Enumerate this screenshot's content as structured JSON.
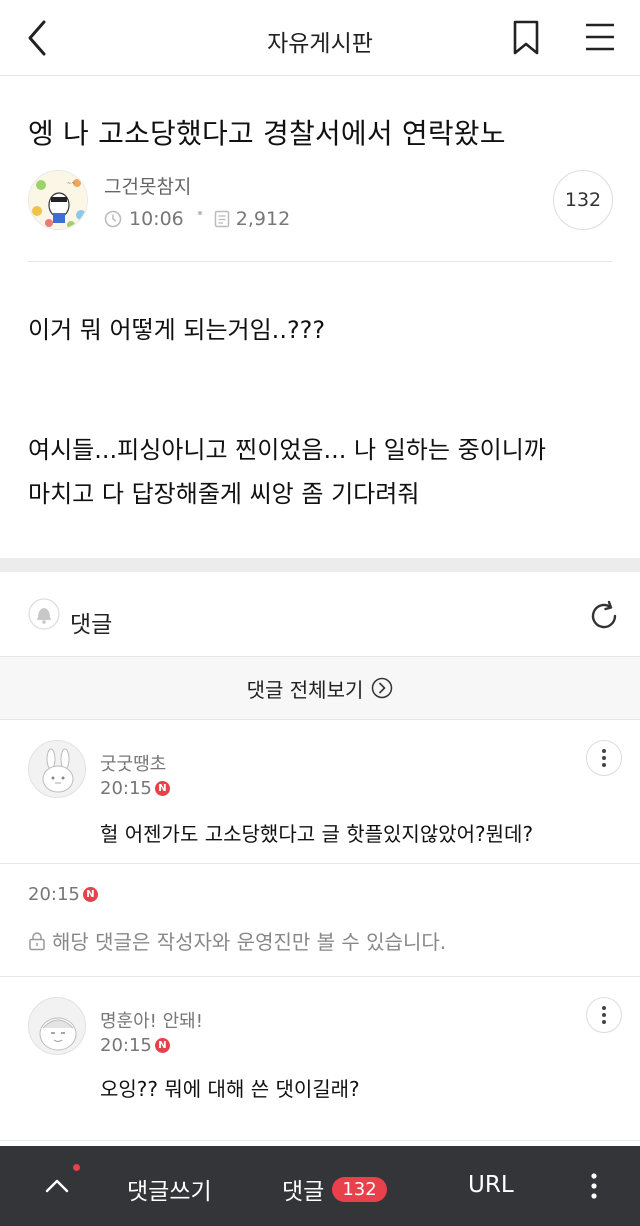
{
  "header": {
    "title": "자유게시판",
    "back_icon": "chevron-left-icon",
    "bookmark_icon": "bookmark-icon",
    "menu_icon": "hamburger-menu-icon"
  },
  "post": {
    "title": "엥 나 고소당했다고 경찰서에서 연락왔노",
    "author": "그건못참지",
    "time": "10:06",
    "views": "2,912",
    "comment_count": "132",
    "body_line1": "이거 뭐 어떻게 되는거임..???",
    "body_line2": "여시들...피싱아니고 찐이었음... 나 일하는 중이니까",
    "body_line3": "마치고 다 답장해줄게 씨앙 좀 기다려줘"
  },
  "comments_section": {
    "label": "댓글",
    "view_all": "댓글 전체보기",
    "items": [
      {
        "name": "굿굿땡초",
        "time": "20:15",
        "text": "헐 어젠가도 고소당했다고 글 핫플있지않았어?뭔데?"
      },
      {
        "time": "20:15",
        "text": "해당 댓글은 작성자와 운영진만 볼 수 있습니다."
      },
      {
        "name": "명훈아! 안돼!",
        "time": "20:15",
        "text": "오잉?? 뭐에 대해 쓴 댓이길래?"
      }
    ],
    "new_badge": "N"
  },
  "bottom_bar": {
    "write_comment": "댓글쓰기",
    "comments": "댓글",
    "comments_count": "132",
    "url": "URL"
  },
  "colors": {
    "accent_red": "#e8414b",
    "bottom_bar_bg": "#333538",
    "band_gray": "#ececec"
  }
}
